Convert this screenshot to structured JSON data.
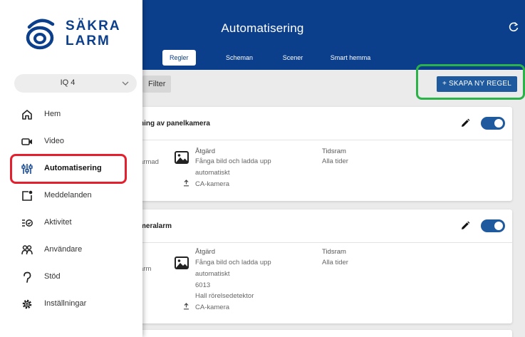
{
  "header": {
    "title": "Automatisering",
    "refresh_icon": "refresh-icon",
    "tabs": [
      "Regler",
      "Scheman",
      "Scener",
      "Smart hemma"
    ],
    "active_tab": "Regler"
  },
  "toolbar": {
    "filter_label": "Filter",
    "create_label": "+  SKAPA NY REGEL"
  },
  "rules": [
    {
      "title": "ning av panelkamera",
      "trigger_fragment": "armad",
      "action_label": "Åtgärd",
      "action_lines": [
        "Fånga bild och ladda upp",
        "automatiskt"
      ],
      "upload_label": "CA-kamera",
      "time_label": "Tidsram",
      "time_value": "Alla tider",
      "enabled": true
    },
    {
      "title": "meralarm",
      "trigger_fragment": "arm",
      "action_label": "Åtgärd",
      "action_lines": [
        "Fånga bild och ladda upp",
        "automatiskt",
        "6013",
        "Hall rörelsedetektor"
      ],
      "upload_label": "CA-kamera",
      "time_label": "Tidsram",
      "time_value": "Alla tider",
      "enabled": true
    }
  ],
  "sidebar": {
    "logo_line1": "SÄKRA",
    "logo_line2": "LARM",
    "site_select": "IQ 4",
    "items": [
      {
        "label": "Hem",
        "icon": "home-icon"
      },
      {
        "label": "Video",
        "icon": "video-camera-icon"
      },
      {
        "label": "Automatisering",
        "icon": "sliders-icon",
        "active": true
      },
      {
        "label": "Meddelanden",
        "icon": "message-icon"
      },
      {
        "label": "Aktivitet",
        "icon": "activity-list-icon"
      },
      {
        "label": "Användare",
        "icon": "users-icon"
      },
      {
        "label": "Stöd",
        "icon": "support-icon"
      },
      {
        "label": "Inställningar",
        "icon": "gear-icon"
      }
    ]
  },
  "colors": {
    "header": "#0b3f8c",
    "accent": "#1f5a9e",
    "highlight_red": "#e5202e",
    "highlight_green": "#2bb34a"
  }
}
